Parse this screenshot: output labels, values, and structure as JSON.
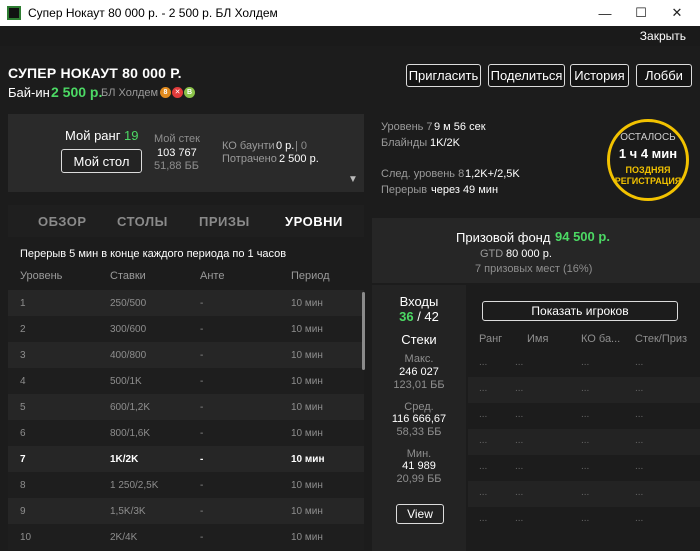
{
  "window": {
    "title": "Супер Нокаут 80 000 р. - 2 500 р. БЛ Холдем",
    "close_link": "Закрыть"
  },
  "header": {
    "tournament_name": "СУПЕР НОКАУТ 80 000 Р.",
    "buyin_label": "Бай-ин",
    "buyin_value": "2 500 р.",
    "game": "БЛ Холдем",
    "buttons": {
      "invite": "Пригласить",
      "share": "Поделиться",
      "history": "История",
      "lobby": "Лобби"
    }
  },
  "rank": {
    "label": "Мой ранг",
    "value": "19",
    "my_table_button": "Мой стол",
    "stack_label": "Мой стек",
    "stack_value": "103 767",
    "stack_bb": "51,88 ББ",
    "ko_label": "КО баунти",
    "ko_value": "0 р.",
    "ko_extra": "| 0",
    "spent_label": "Потрачено",
    "spent_value": "2 500 р."
  },
  "tabs": [
    "ОБЗОР",
    "СТОЛЫ",
    "ПРИЗЫ",
    "УРОВНИ"
  ],
  "levels": {
    "break_info": "Перерыв 5 мин в конце каждого периода по 1 часов",
    "columns": [
      "Уровень",
      "Ставки",
      "Анте",
      "Период"
    ],
    "rows": [
      [
        "1",
        "250/500",
        "-",
        "10 мин"
      ],
      [
        "2",
        "300/600",
        "-",
        "10 мин"
      ],
      [
        "3",
        "400/800",
        "-",
        "10 мин"
      ],
      [
        "4",
        "500/1K",
        "-",
        "10 мин"
      ],
      [
        "5",
        "600/1,2K",
        "-",
        "10 мин"
      ],
      [
        "6",
        "800/1,6K",
        "-",
        "10 мин"
      ],
      [
        "7",
        "1K/2K",
        "-",
        "10 мин"
      ],
      [
        "8",
        "1 250/2,5K",
        "-",
        "10 мин"
      ],
      [
        "9",
        "1,5K/3K",
        "-",
        "10 мин"
      ],
      [
        "10",
        "2K/4K",
        "-",
        "10 мин"
      ]
    ],
    "current_level_index": 6
  },
  "level_info": {
    "level_label": "Уровень 7",
    "level_time": "9 м 56 сек",
    "blinds_label": "Блайнды",
    "blinds_value": "1K/2K",
    "next_label": "След. уровень 8",
    "next_value": "1,2K+/2,5K",
    "break_label": "Перерыв",
    "break_value": "через 49 мин"
  },
  "timer": {
    "remaining_label": "ОСТАЛОСЬ",
    "remaining_value": "1 ч 4 мин",
    "late_reg": "ПОЗДНЯЯ РЕГИСТРАЦИЯ"
  },
  "prize": {
    "label": "Призовой фонд",
    "value": "94 500 р.",
    "gtd_label": "GTD",
    "gtd_value": "80 000 р.",
    "places": "7 призовых мест (16%)"
  },
  "entries": {
    "label": "Входы",
    "current": "36",
    "total": "/ 42",
    "stacks_label": "Стеки",
    "max_label": "Макс.",
    "max_value": "246 027",
    "max_bb": "123,01 ББ",
    "avg_label": "Сред.",
    "avg_value": "116 666,67",
    "avg_bb": "58,33 ББ",
    "min_label": "Мин.",
    "min_value": "41 989",
    "min_bb": "20,99 ББ",
    "view_button": "View"
  },
  "players": {
    "show_button": "Показать игроков",
    "columns": [
      "Ранг",
      "Имя",
      "КО ба...",
      "Стек/Приз"
    ],
    "placeholder": "..."
  },
  "colors": {
    "accent_green": "#4cd964",
    "timer_yellow": "#f2c200"
  },
  "icons": {
    "badges": [
      "bounty-8-icon",
      "ko-icon",
      "knockout-b-icon"
    ]
  }
}
